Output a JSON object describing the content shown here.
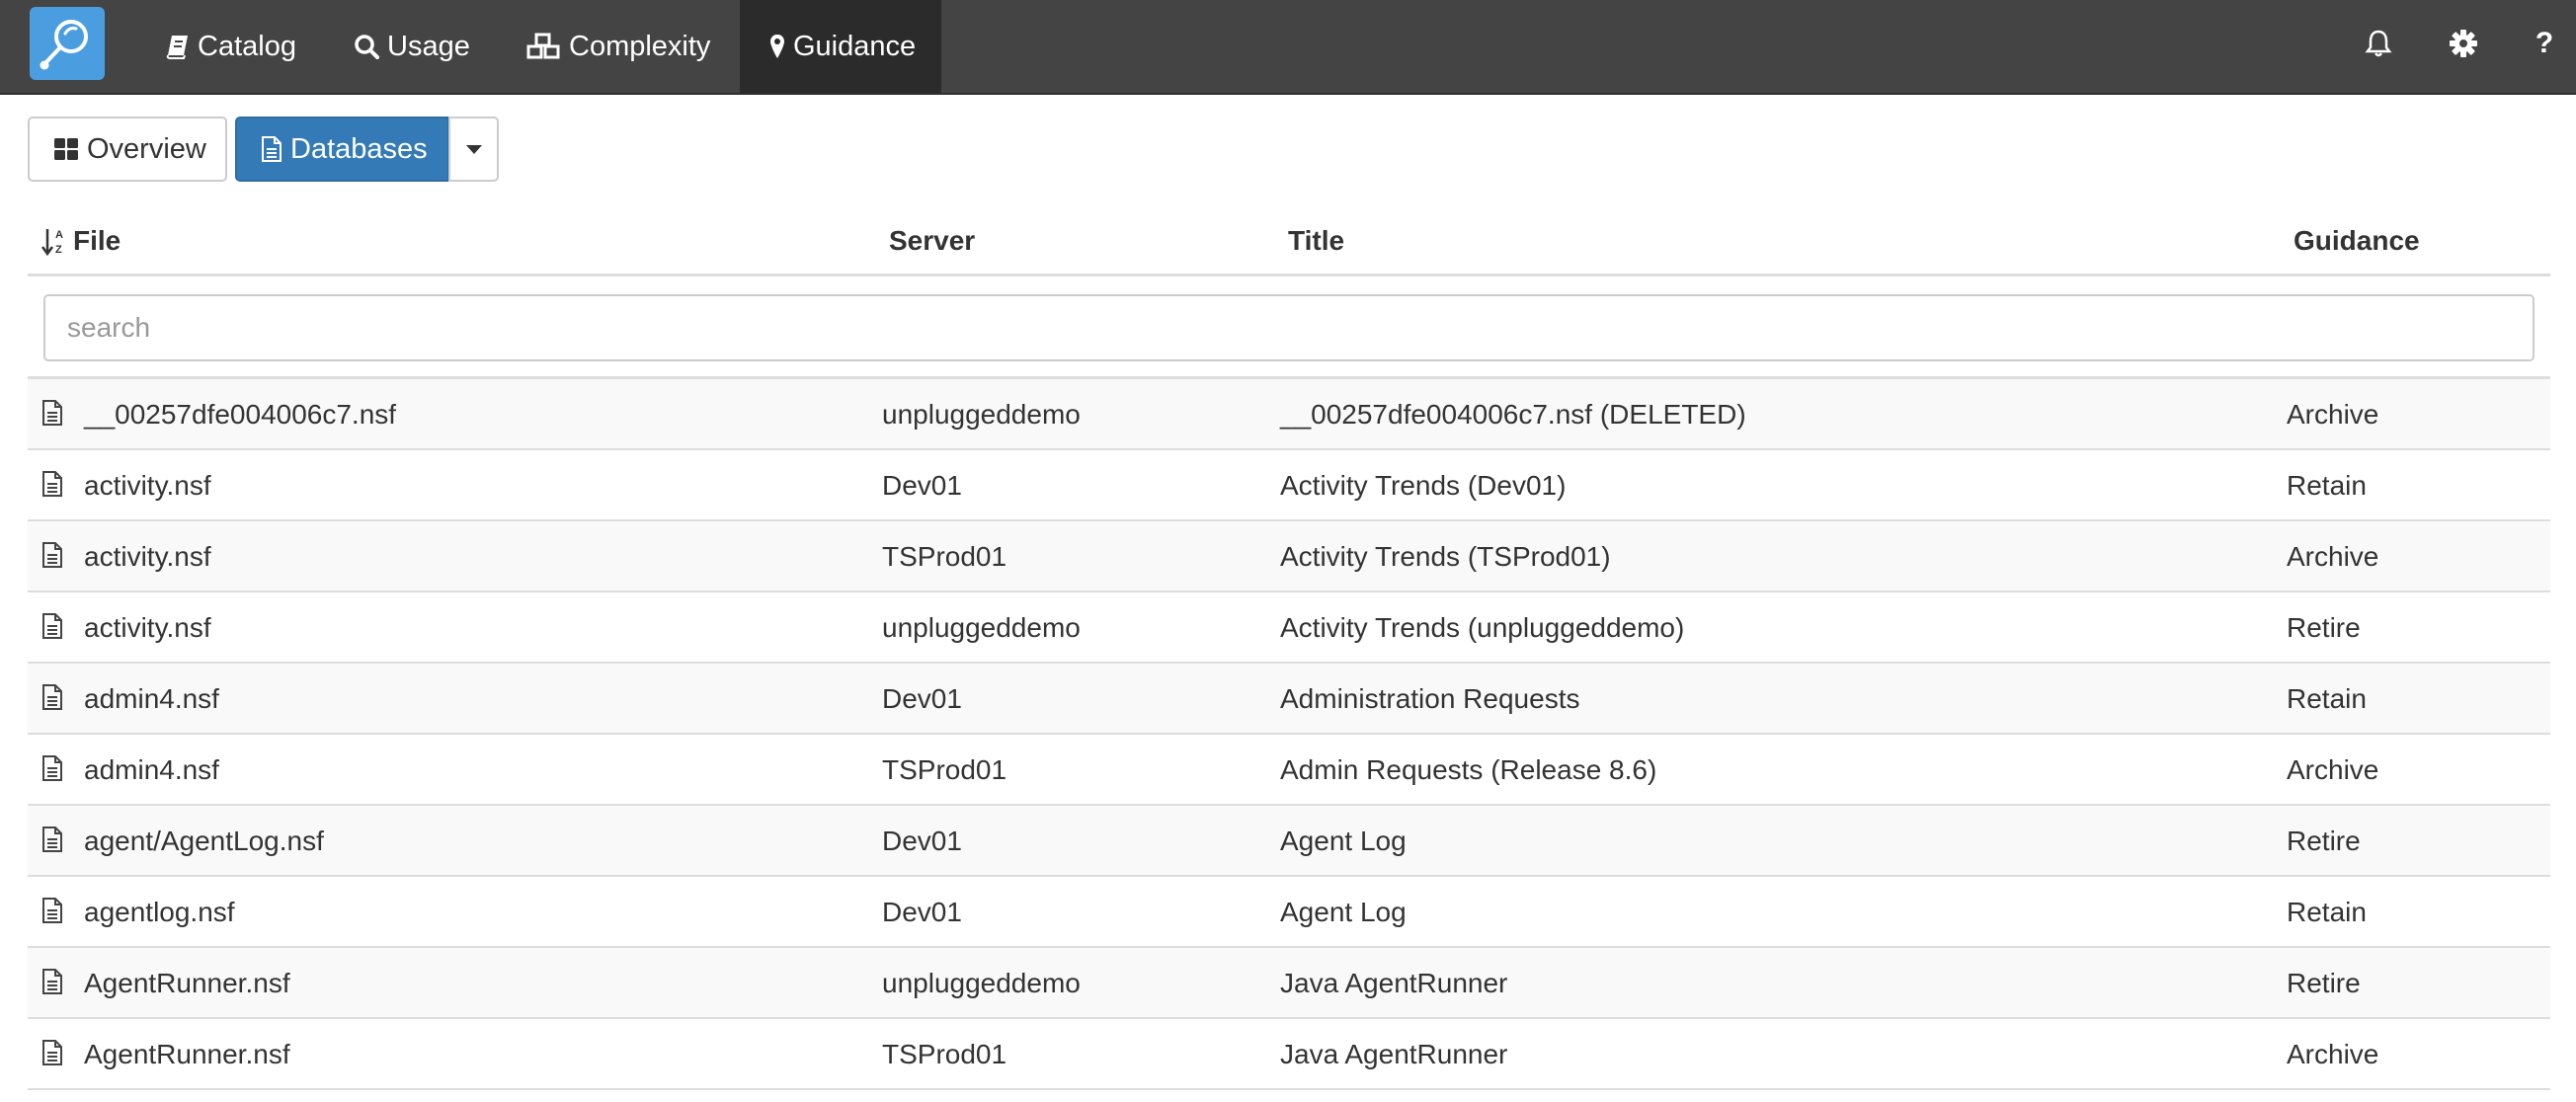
{
  "nav": {
    "logo_icon": "magnifier-logo-icon",
    "items": [
      {
        "label": "Catalog",
        "icon": "book-icon"
      },
      {
        "label": "Usage",
        "icon": "search-icon"
      },
      {
        "label": "Complexity",
        "icon": "cubes-icon"
      },
      {
        "label": "Guidance",
        "icon": "map-marker-icon",
        "active": true
      }
    ],
    "right_icons": [
      "bell-icon",
      "gear-icon",
      "help-icon"
    ],
    "help_label": "?",
    "bar_color": "#444444",
    "active_color": "#2b2b2b"
  },
  "toolbar": {
    "overview_label": "Overview",
    "databases_label": "Databases",
    "active_color": "#337ab7"
  },
  "table": {
    "columns": {
      "file": "File",
      "server": "Server",
      "title": "Title",
      "guidance": "Guidance"
    },
    "sort_icon": "sort-alpha-asc-icon",
    "search_placeholder": "search",
    "rows": [
      {
        "file": "__00257dfe004006c7.nsf",
        "server": "unpluggeddemo",
        "title": "__00257dfe004006c7.nsf (DELETED)",
        "guidance": "Archive"
      },
      {
        "file": "activity.nsf",
        "server": "Dev01",
        "title": "Activity Trends (Dev01)",
        "guidance": "Retain"
      },
      {
        "file": "activity.nsf",
        "server": "TSProd01",
        "title": "Activity Trends (TSProd01)",
        "guidance": "Archive"
      },
      {
        "file": "activity.nsf",
        "server": "unpluggeddemo",
        "title": "Activity Trends (unpluggeddemo)",
        "guidance": "Retire"
      },
      {
        "file": "admin4.nsf",
        "server": "Dev01",
        "title": "Administration Requests",
        "guidance": "Retain"
      },
      {
        "file": "admin4.nsf",
        "server": "TSProd01",
        "title": "Admin Requests (Release 8.6)",
        "guidance": "Archive"
      },
      {
        "file": "agent/AgentLog.nsf",
        "server": "Dev01",
        "title": "Agent Log",
        "guidance": "Retire"
      },
      {
        "file": "agentlog.nsf",
        "server": "Dev01",
        "title": "Agent Log",
        "guidance": "Retain"
      },
      {
        "file": "AgentRunner.nsf",
        "server": "unpluggeddemo",
        "title": "Java AgentRunner",
        "guidance": "Retire"
      },
      {
        "file": "AgentRunner.nsf",
        "server": "TSProd01",
        "title": "Java AgentRunner",
        "guidance": "Archive"
      }
    ]
  }
}
